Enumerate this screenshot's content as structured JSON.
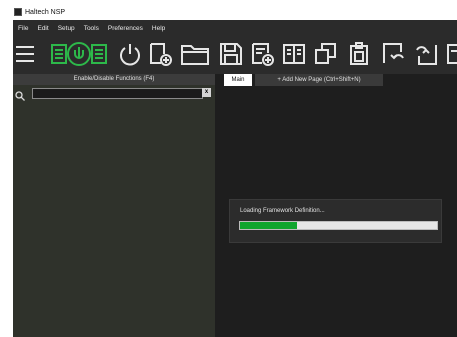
{
  "window": {
    "title": "Haltech NSP"
  },
  "menu": [
    "File",
    "Edit",
    "Setup",
    "Tools",
    "Preferences",
    "Help"
  ],
  "toolbar": {
    "buttons": [
      {
        "name": "menu-icon"
      },
      {
        "name": "ecu-connect-icon"
      },
      {
        "name": "power-icon"
      },
      {
        "name": "new-file-icon"
      },
      {
        "name": "open-folder-icon"
      },
      {
        "name": "save-icon"
      },
      {
        "name": "save-as-icon"
      },
      {
        "name": "compare-icon"
      },
      {
        "name": "copy-icon"
      },
      {
        "name": "clipboard-icon"
      },
      {
        "name": "undo-icon"
      },
      {
        "name": "redo-icon"
      }
    ],
    "accent": "#2db84a"
  },
  "left_panel": {
    "header": "Enable/Disable Functions (F4)",
    "search_value": "",
    "clear_label": "x"
  },
  "tabs": {
    "main": "Main",
    "add": "+ Add New Page (Ctrl+Shift+N)"
  },
  "loading": {
    "text": "Loading Framework Definition...",
    "progress": 0.29,
    "color": "#0fa52d"
  }
}
